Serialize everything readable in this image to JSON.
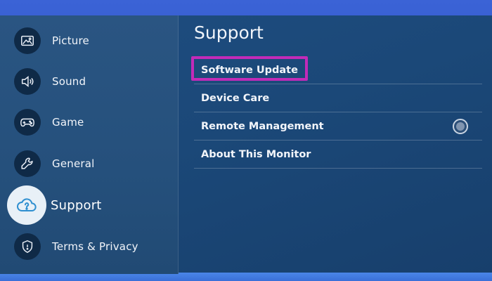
{
  "sidebar": {
    "items": [
      {
        "label": "Picture",
        "icon": "picture-icon"
      },
      {
        "label": "Sound",
        "icon": "sound-icon"
      },
      {
        "label": "Game",
        "icon": "game-controller-icon"
      },
      {
        "label": "General",
        "icon": "wrench-icon"
      },
      {
        "label": "Support",
        "icon": "cloud-help-icon",
        "active": true
      },
      {
        "label": "Terms & Privacy",
        "icon": "shield-icon"
      }
    ]
  },
  "main": {
    "title": "Support",
    "menu": [
      {
        "label": "Software Update",
        "focused": true
      },
      {
        "label": "Device Care"
      },
      {
        "label": "Remote Management",
        "toggle": "off"
      },
      {
        "label": "About This Monitor"
      }
    ]
  },
  "colors": {
    "focus_highlight": "#c22bb8",
    "panel_bg": "#1b4878",
    "sidebar_bg": "#25507c"
  }
}
